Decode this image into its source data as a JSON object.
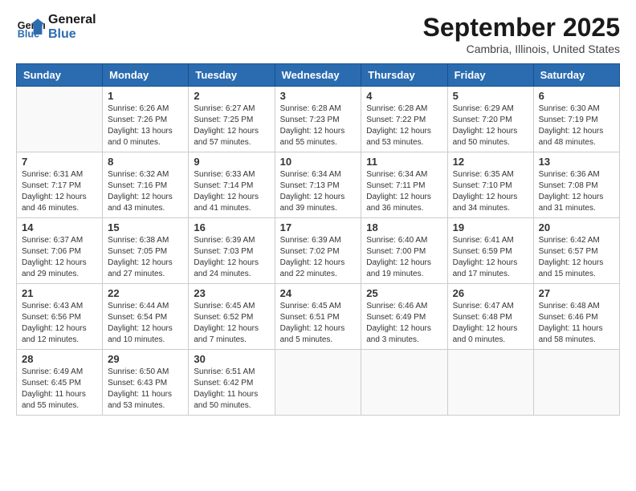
{
  "logo": {
    "line1": "General",
    "line2": "Blue"
  },
  "title": "September 2025",
  "location": "Cambria, Illinois, United States",
  "days_header": [
    "Sunday",
    "Monday",
    "Tuesday",
    "Wednesday",
    "Thursday",
    "Friday",
    "Saturday"
  ],
  "weeks": [
    [
      {
        "day": "",
        "info": ""
      },
      {
        "day": "1",
        "info": "Sunrise: 6:26 AM\nSunset: 7:26 PM\nDaylight: 13 hours\nand 0 minutes."
      },
      {
        "day": "2",
        "info": "Sunrise: 6:27 AM\nSunset: 7:25 PM\nDaylight: 12 hours\nand 57 minutes."
      },
      {
        "day": "3",
        "info": "Sunrise: 6:28 AM\nSunset: 7:23 PM\nDaylight: 12 hours\nand 55 minutes."
      },
      {
        "day": "4",
        "info": "Sunrise: 6:28 AM\nSunset: 7:22 PM\nDaylight: 12 hours\nand 53 minutes."
      },
      {
        "day": "5",
        "info": "Sunrise: 6:29 AM\nSunset: 7:20 PM\nDaylight: 12 hours\nand 50 minutes."
      },
      {
        "day": "6",
        "info": "Sunrise: 6:30 AM\nSunset: 7:19 PM\nDaylight: 12 hours\nand 48 minutes."
      }
    ],
    [
      {
        "day": "7",
        "info": "Sunrise: 6:31 AM\nSunset: 7:17 PM\nDaylight: 12 hours\nand 46 minutes."
      },
      {
        "day": "8",
        "info": "Sunrise: 6:32 AM\nSunset: 7:16 PM\nDaylight: 12 hours\nand 43 minutes."
      },
      {
        "day": "9",
        "info": "Sunrise: 6:33 AM\nSunset: 7:14 PM\nDaylight: 12 hours\nand 41 minutes."
      },
      {
        "day": "10",
        "info": "Sunrise: 6:34 AM\nSunset: 7:13 PM\nDaylight: 12 hours\nand 39 minutes."
      },
      {
        "day": "11",
        "info": "Sunrise: 6:34 AM\nSunset: 7:11 PM\nDaylight: 12 hours\nand 36 minutes."
      },
      {
        "day": "12",
        "info": "Sunrise: 6:35 AM\nSunset: 7:10 PM\nDaylight: 12 hours\nand 34 minutes."
      },
      {
        "day": "13",
        "info": "Sunrise: 6:36 AM\nSunset: 7:08 PM\nDaylight: 12 hours\nand 31 minutes."
      }
    ],
    [
      {
        "day": "14",
        "info": "Sunrise: 6:37 AM\nSunset: 7:06 PM\nDaylight: 12 hours\nand 29 minutes."
      },
      {
        "day": "15",
        "info": "Sunrise: 6:38 AM\nSunset: 7:05 PM\nDaylight: 12 hours\nand 27 minutes."
      },
      {
        "day": "16",
        "info": "Sunrise: 6:39 AM\nSunset: 7:03 PM\nDaylight: 12 hours\nand 24 minutes."
      },
      {
        "day": "17",
        "info": "Sunrise: 6:39 AM\nSunset: 7:02 PM\nDaylight: 12 hours\nand 22 minutes."
      },
      {
        "day": "18",
        "info": "Sunrise: 6:40 AM\nSunset: 7:00 PM\nDaylight: 12 hours\nand 19 minutes."
      },
      {
        "day": "19",
        "info": "Sunrise: 6:41 AM\nSunset: 6:59 PM\nDaylight: 12 hours\nand 17 minutes."
      },
      {
        "day": "20",
        "info": "Sunrise: 6:42 AM\nSunset: 6:57 PM\nDaylight: 12 hours\nand 15 minutes."
      }
    ],
    [
      {
        "day": "21",
        "info": "Sunrise: 6:43 AM\nSunset: 6:56 PM\nDaylight: 12 hours\nand 12 minutes."
      },
      {
        "day": "22",
        "info": "Sunrise: 6:44 AM\nSunset: 6:54 PM\nDaylight: 12 hours\nand 10 minutes."
      },
      {
        "day": "23",
        "info": "Sunrise: 6:45 AM\nSunset: 6:52 PM\nDaylight: 12 hours\nand 7 minutes."
      },
      {
        "day": "24",
        "info": "Sunrise: 6:45 AM\nSunset: 6:51 PM\nDaylight: 12 hours\nand 5 minutes."
      },
      {
        "day": "25",
        "info": "Sunrise: 6:46 AM\nSunset: 6:49 PM\nDaylight: 12 hours\nand 3 minutes."
      },
      {
        "day": "26",
        "info": "Sunrise: 6:47 AM\nSunset: 6:48 PM\nDaylight: 12 hours\nand 0 minutes."
      },
      {
        "day": "27",
        "info": "Sunrise: 6:48 AM\nSunset: 6:46 PM\nDaylight: 11 hours\nand 58 minutes."
      }
    ],
    [
      {
        "day": "28",
        "info": "Sunrise: 6:49 AM\nSunset: 6:45 PM\nDaylight: 11 hours\nand 55 minutes."
      },
      {
        "day": "29",
        "info": "Sunrise: 6:50 AM\nSunset: 6:43 PM\nDaylight: 11 hours\nand 53 minutes."
      },
      {
        "day": "30",
        "info": "Sunrise: 6:51 AM\nSunset: 6:42 PM\nDaylight: 11 hours\nand 50 minutes."
      },
      {
        "day": "",
        "info": ""
      },
      {
        "day": "",
        "info": ""
      },
      {
        "day": "",
        "info": ""
      },
      {
        "day": "",
        "info": ""
      }
    ]
  ]
}
